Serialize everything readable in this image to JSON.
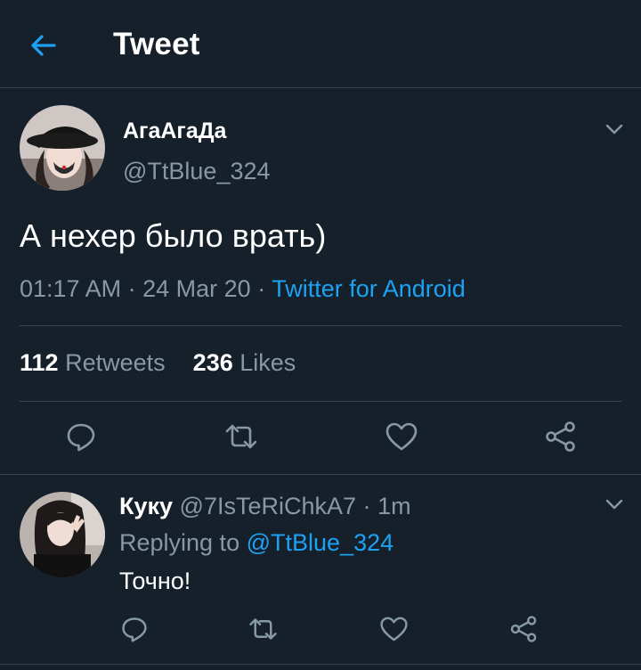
{
  "header": {
    "title": "Tweet",
    "back_icon": "arrow-left-icon",
    "accent": "#1da1f2"
  },
  "tweet": {
    "author_name": "АгаАгаДа",
    "author_handle": "@TtBlue_324",
    "text": "А нехер было врать)",
    "time": "01:17 AM",
    "date": "24 Mar 20",
    "separator": "·",
    "source": "Twitter for Android",
    "retweets_count": "112",
    "retweets_label": "Retweets",
    "likes_count": "236",
    "likes_label": "Likes",
    "actions": [
      "reply-icon",
      "retweet-icon",
      "like-icon",
      "share-icon"
    ]
  },
  "reply": {
    "author_name": "Куку",
    "author_handle": "@7IsTeRiChkA7",
    "separator": "·",
    "time": "1m",
    "replying_prefix": "Replying to",
    "replying_handle": "@TtBlue_324",
    "text": "Точно!",
    "actions": [
      "reply-icon",
      "retweet-icon",
      "like-icon",
      "share-icon"
    ]
  },
  "colors": {
    "background": "#15202b",
    "muted": "#8899a6",
    "divider": "#38444d",
    "link": "#1da1f2"
  }
}
